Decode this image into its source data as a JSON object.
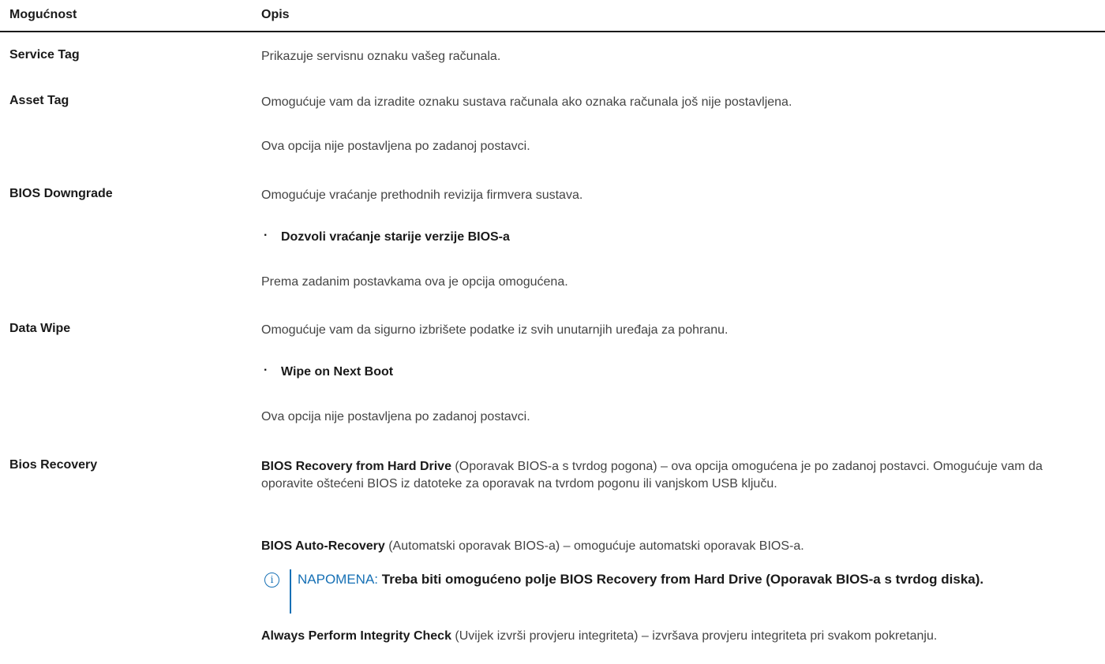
{
  "header": {
    "col_option": "Mogućnost",
    "col_description": "Opis"
  },
  "rows": [
    {
      "option": "Service Tag",
      "paragraphs": [
        "Prikazuje servisnu oznaku vašeg računala."
      ]
    },
    {
      "option": "Asset Tag",
      "paragraphs": [
        "Omogućuje vam da izradite oznaku sustava računala ako oznaka računala još nije postavljena.",
        "Ova opcija nije postavljena po zadanoj postavci."
      ]
    },
    {
      "option": "BIOS Downgrade",
      "paragraphs": [
        "Omogućuje vraćanje prethodnih revizija firmvera sustava."
      ],
      "bullet": "Dozvoli vraćanje starije verzije BIOS-a",
      "after": "Prema zadanim postavkama ova je opcija omogućena."
    },
    {
      "option": "Data Wipe",
      "paragraphs": [
        "Omogućuje vam da sigurno izbrišete podatke iz svih unutarnjih uređaja za pohranu."
      ],
      "bullet": "Wipe on Next Boot",
      "after": "Ova opcija nije postavljena po zadanoj postavci."
    },
    {
      "option": "Bios Recovery",
      "p1_bold": "BIOS Recovery from Hard Drive",
      "p1_rest": " (Oporavak BIOS-a s tvrdog pogona) – ova opcija omogućena je po zadanoj postavci. Omogućuje vam da oporavite oštećeni BIOS iz datoteke za oporavak na tvrdom pogonu ili vanjskom USB ključu.",
      "p2_bold": "BIOS Auto-Recovery",
      "p2_rest": " (Automatski oporavak BIOS-a) – omogućuje automatski oporavak BIOS-a.",
      "note_label": "NAPOMENA:",
      "note_text": " Treba biti omogućeno polje BIOS Recovery from Hard Drive (Oporavak BIOS-a s tvrdog diska).",
      "p3_bold": "Always Perform Integrity Check",
      "p3_rest": " (Uvijek izvrši provjeru integriteta) – izvršava provjeru integriteta pri svakom pokretanju."
    }
  ],
  "icons": {
    "note_icon": "info-icon",
    "note_color": "#1670b5"
  }
}
